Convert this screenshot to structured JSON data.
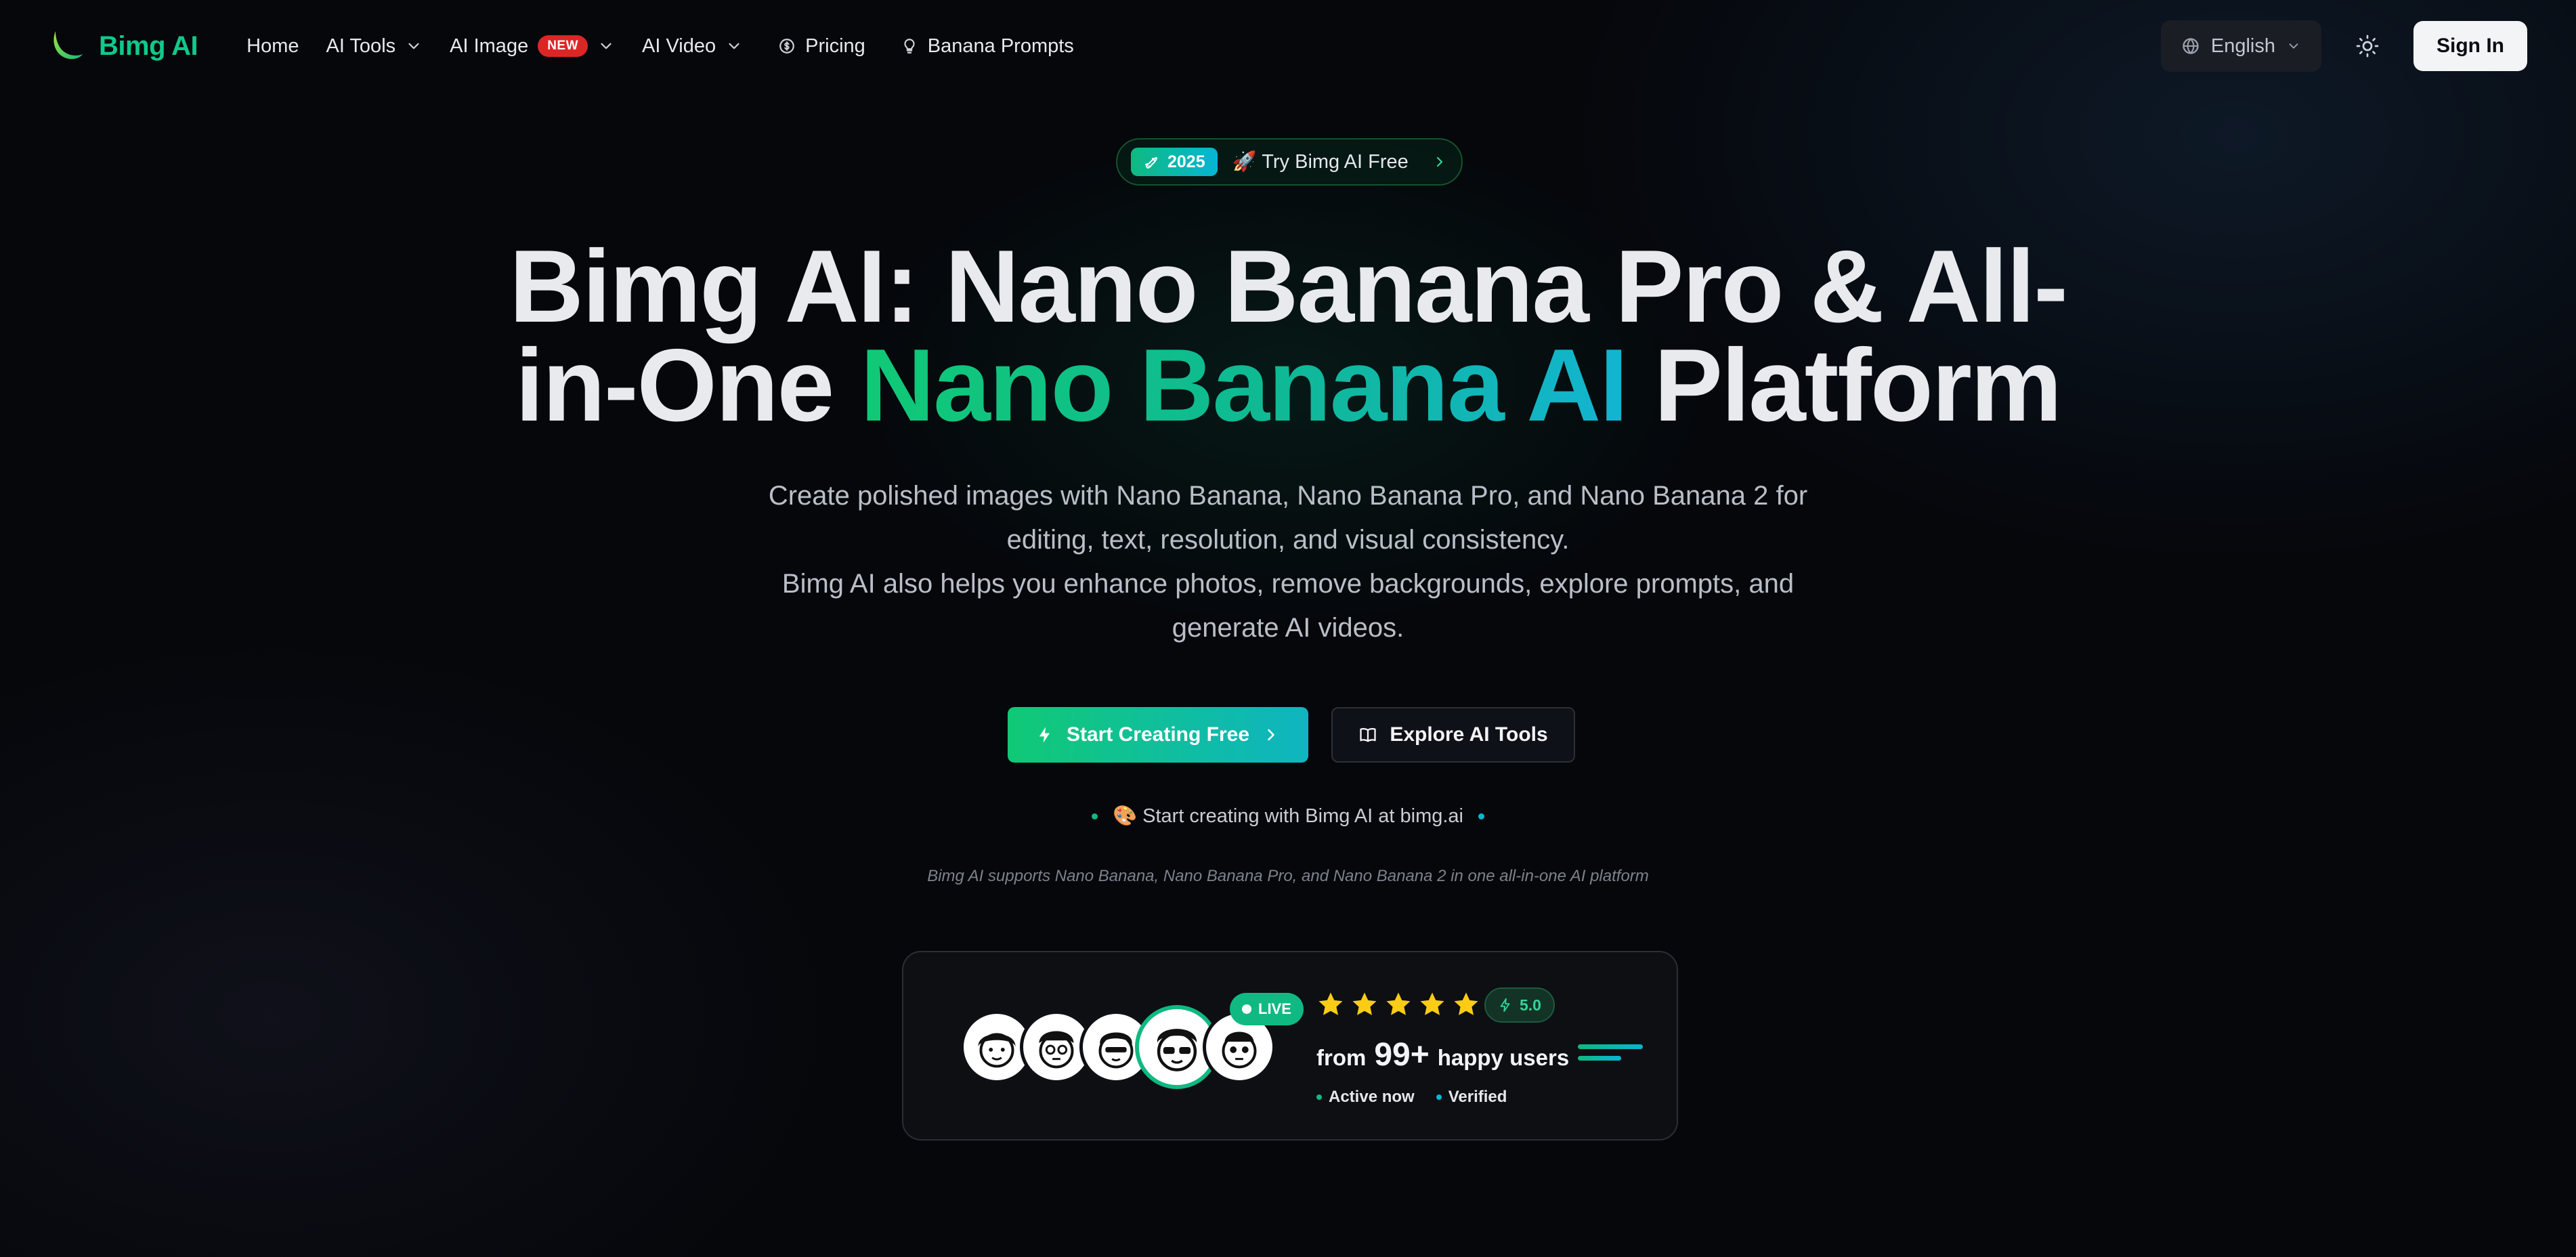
{
  "nav": {
    "logo_text": "Bimg AI",
    "links": {
      "home": "Home",
      "ai_tools": "AI Tools",
      "ai_image": "AI Image",
      "ai_image_badge": "NEW",
      "ai_video": "AI Video",
      "pricing": "Pricing",
      "banana_prompts": "Banana Prompts"
    },
    "language": "English",
    "sign_in": "Sign In"
  },
  "hero": {
    "pill_year": "2025",
    "pill_text": "🚀 Try Bimg AI Free",
    "title_line1": "Bimg AI: Nano Banana Pro & All-",
    "title_line2_start": "in-One ",
    "title_highlight": "Nano Banana AI",
    "title_line2_end": " Platform",
    "subtitle_p1": "Create polished images with Nano Banana, Nano Banana Pro, and Nano Banana 2 for editing, text, resolution, and visual consistency.",
    "subtitle_p2": "Bimg AI also helps you enhance photos, remove backgrounds, explore prompts, and generate AI videos.",
    "cta_primary": "Start Creating Free",
    "cta_secondary": "Explore AI Tools",
    "note": "🎨 Start creating with Bimg AI at bimg.ai",
    "caption": "Bimg AI supports Nano Banana, Nano Banana Pro, and Nano Banana 2 in one all-in-one AI platform"
  },
  "proof": {
    "live_label": "LIVE",
    "stars": 5,
    "rating": "5.0",
    "users_prefix": "from",
    "users_count": "99+",
    "users_suffix": "happy users",
    "status_active": "Active now",
    "status_verified": "Verified"
  },
  "colors": {
    "brand_green": "#10c98a",
    "accent_cyan": "#06b6d4",
    "badge_red": "#dc2626",
    "star_yellow": "#facc15",
    "background": "#05070b"
  },
  "icons": [
    "logo-mark-icon",
    "chevron-down-icon",
    "dollar-icon",
    "lightbulb-icon",
    "globe-icon",
    "sun-icon",
    "rocket-icon",
    "bolt-icon",
    "book-icon",
    "chevron-right-icon",
    "star-icon"
  ]
}
